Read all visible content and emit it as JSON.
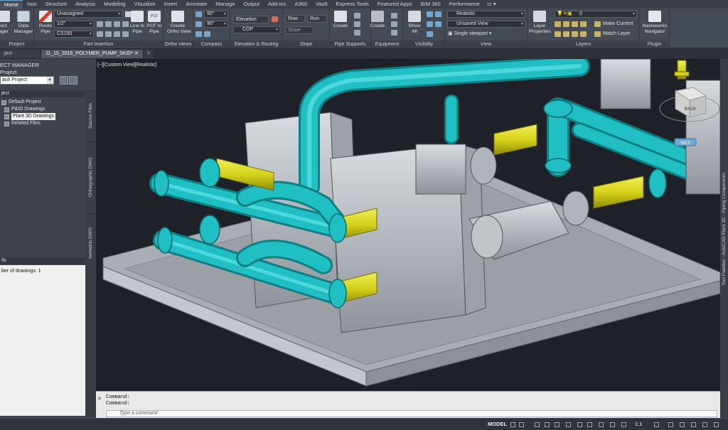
{
  "ribbon_tabs": [
    "Home",
    "Isos",
    "Structure",
    "Analysis",
    "Modeling",
    "Visualize",
    "Insert",
    "Annotate",
    "Manage",
    "Output",
    "Add-ins",
    "A360",
    "Vault",
    "Express Tools",
    "Featured Apps",
    "BIM 360",
    "Performance"
  ],
  "ribbon": {
    "project": {
      "title": "Project",
      "manager_label": "ect\nager"
    },
    "data_manager": "Data\nManager",
    "part_insertion": {
      "title": "Part Insertion",
      "route_pipe": "Route\nPipe",
      "service": "Unassigned",
      "size": "1/2\"",
      "spec": "CS150"
    },
    "line_to_pipe": "Line to\nPipe",
    "pcf_to_pipe": "PCF to\nPipe",
    "pcf_badge": "PCF",
    "ortho_views": {
      "title": "Ortho Views",
      "create": "Create\nOrtho View"
    },
    "compass": {
      "title": "Compass",
      "angle1": "90°",
      "angle2": "90°"
    },
    "elevation_routing": {
      "title": "Elevation & Routing",
      "elevation": "Elevation",
      "cop": "COP"
    },
    "slope": {
      "title": "Slope",
      "rise": "Rise",
      "run": "Run",
      "slope": "Slope"
    },
    "pipe_supports": {
      "title": "Pipe Supports",
      "create": "Create"
    },
    "equipment": {
      "title": "Equipment",
      "create": "Create"
    },
    "visibility": {
      "title": "Visibility",
      "show_all": "Show\nAll"
    },
    "view": {
      "title": "View",
      "visual_style": "Realistic",
      "named_view": "Unsaved View",
      "viewport": "Single viewport"
    },
    "layers": {
      "title": "Layers",
      "layer_properties": "Layer\nProperties",
      "layer_name": "0",
      "make_current": "Make Current",
      "match_layer": "Match Layer"
    },
    "plugin": {
      "title": "Plugin",
      "navisworks": "Navisworks\nNavigator"
    }
  },
  "file_tabs": {
    "left": "ject",
    "active": "11_15_2016_POLYMER_PUMP_SKID*",
    "plus": "+"
  },
  "project_manager": {
    "title": "ECT MANAGER",
    "current": "Project",
    "selected_project": "ault Project",
    "section": "ject",
    "tree": [
      {
        "label": "Default Project",
        "icon": "project-icon"
      },
      {
        "label": "P&ID Drawings",
        "icon": "folder-icon"
      },
      {
        "label": "Plant 3D Drawings",
        "icon": "folder-icon",
        "selected": true
      },
      {
        "label": "Related Files",
        "icon": "folder-icon"
      }
    ],
    "side_tabs": [
      "Source Files",
      "Orthographic DWG",
      "Isometric DWG"
    ],
    "details_title": "ils",
    "details_text": "ber of drawings: 1"
  },
  "viewport": {
    "label": "[−][Custom View][Realistic]",
    "viewcube_face": "BACK",
    "wcs": "WCS"
  },
  "tool_palette": "Tool Palettes - AutoCAD Plant 3D - Piping Components",
  "command": {
    "line1": "Command:",
    "line2": "Command:",
    "placeholder": "Type a command"
  },
  "status": {
    "model": "MODEL",
    "scale": "1:1"
  },
  "colors": {
    "pipe": "#1fbfc4",
    "flange_highlight": "#d6d31a",
    "equipment": "#b9bec4",
    "background": "#1e2228"
  }
}
